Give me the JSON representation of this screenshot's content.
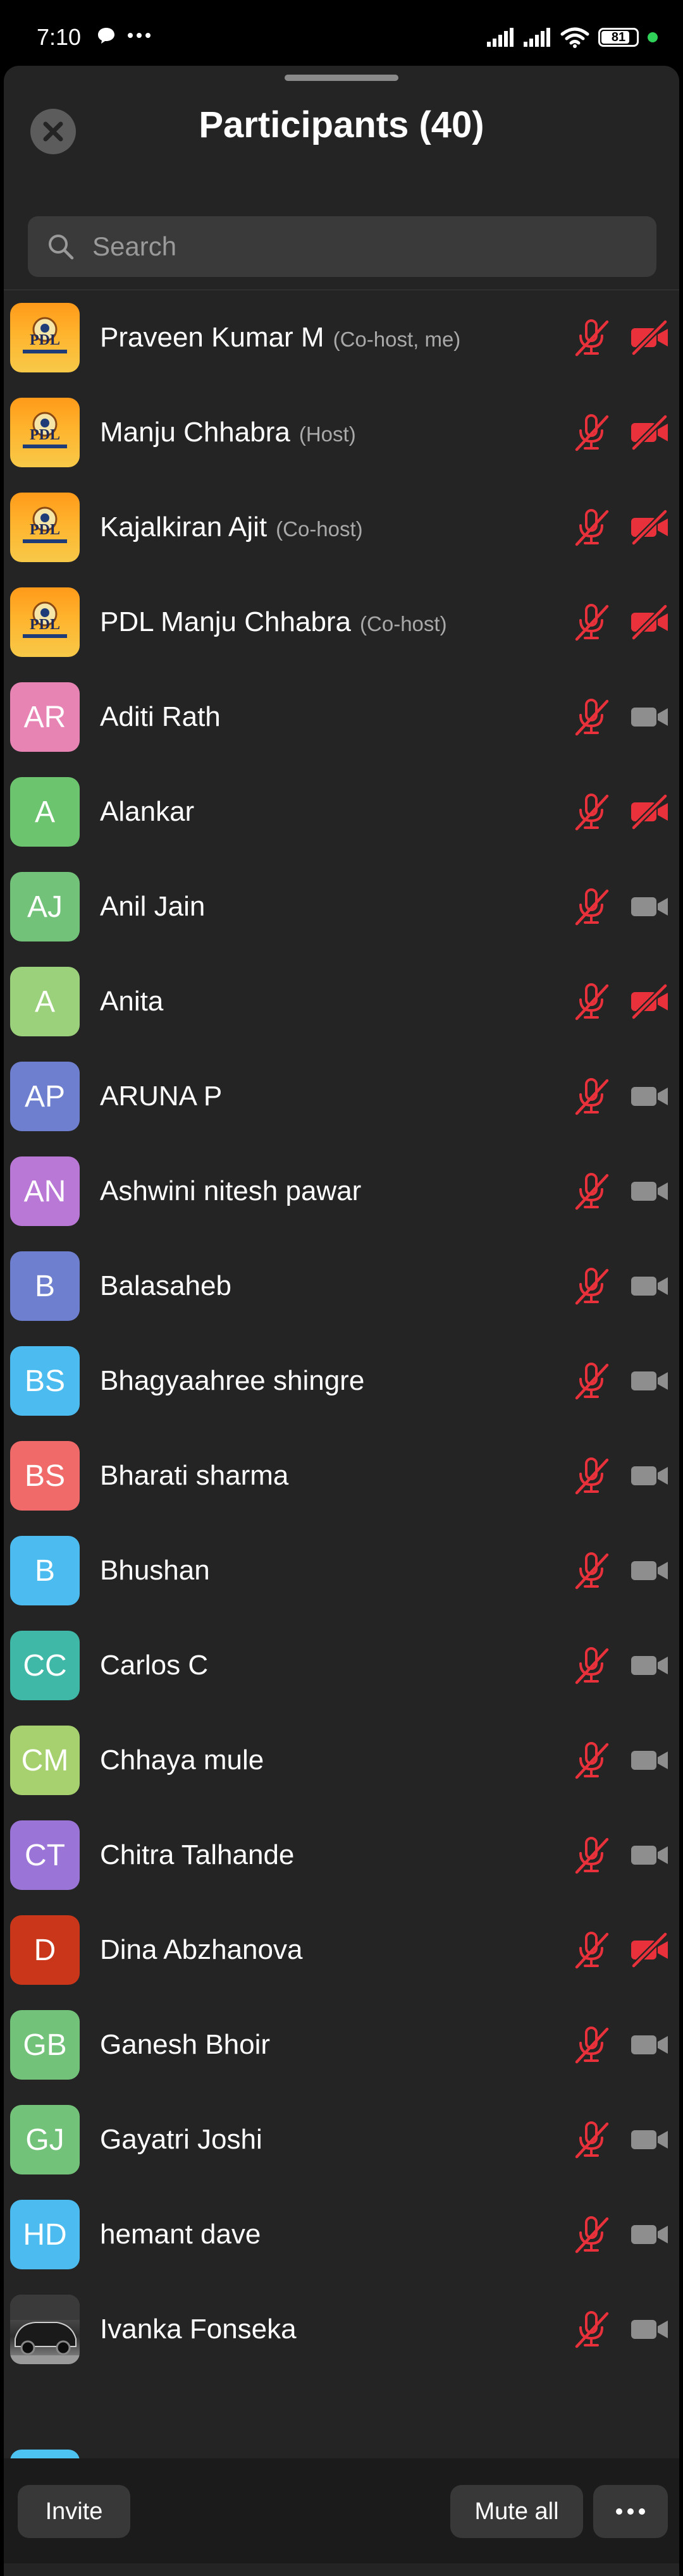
{
  "status_bar": {
    "time": "7:10",
    "battery": "81",
    "battery_level": 0.81,
    "left_icons": [
      "chat-bubble-icon",
      "more-dots-icon"
    ],
    "right_icons": [
      "signal-icon",
      "signal-icon",
      "wifi-icon",
      "battery-icon",
      "green-dot-indicator"
    ]
  },
  "header": {
    "title": "Participants (40)",
    "close_icon": "close-icon"
  },
  "search": {
    "placeholder": "Search",
    "value": ""
  },
  "colors": {
    "sheet_bg": "#242424",
    "muted_red": "#e8313b",
    "camera_grey": "#8e8e8e"
  },
  "participants": [
    {
      "name": "Praveen Kumar M",
      "role": "(Co-host, me)",
      "avatar": "PDL",
      "avatar_kind": "logo",
      "color": "",
      "mic_muted": true,
      "video_off": true
    },
    {
      "name": "Manju Chhabra",
      "role": "(Host)",
      "avatar": "PDL",
      "avatar_kind": "logo",
      "color": "",
      "mic_muted": true,
      "video_off": true
    },
    {
      "name": "Kajalkiran Ajit",
      "role": "(Co-host)",
      "avatar": "PDL",
      "avatar_kind": "logo",
      "color": "",
      "mic_muted": true,
      "video_off": true
    },
    {
      "name": "PDL Manju Chhabra",
      "role": "(Co-host)",
      "avatar": "PDL",
      "avatar_kind": "logo",
      "color": "",
      "mic_muted": true,
      "video_off": true
    },
    {
      "name": "Aditi Rath",
      "role": "",
      "avatar": "AR",
      "avatar_kind": "initials",
      "color": "#e784b4",
      "mic_muted": true,
      "video_off": false
    },
    {
      "name": "Alankar",
      "role": "",
      "avatar": "A",
      "avatar_kind": "initials",
      "color": "#6cc46f",
      "mic_muted": true,
      "video_off": true
    },
    {
      "name": "Anil Jain",
      "role": "",
      "avatar": "AJ",
      "avatar_kind": "initials",
      "color": "#72c27a",
      "mic_muted": true,
      "video_off": false
    },
    {
      "name": "Anita",
      "role": "",
      "avatar": "A",
      "avatar_kind": "initials",
      "color": "#9bd17a",
      "mic_muted": true,
      "video_off": true
    },
    {
      "name": "ARUNA P",
      "role": "",
      "avatar": "AP",
      "avatar_kind": "initials",
      "color": "#6f7fcf",
      "mic_muted": true,
      "video_off": false
    },
    {
      "name": "Ashwini nitesh pawar",
      "role": "",
      "avatar": "AN",
      "avatar_kind": "initials",
      "color": "#b977d6",
      "mic_muted": true,
      "video_off": false
    },
    {
      "name": "Balasaheb",
      "role": "",
      "avatar": "B",
      "avatar_kind": "initials",
      "color": "#6f7fcf",
      "mic_muted": true,
      "video_off": false
    },
    {
      "name": "Bhagyaahree shingre",
      "role": "",
      "avatar": "BS",
      "avatar_kind": "initials",
      "color": "#4cbcf0",
      "mic_muted": true,
      "video_off": false
    },
    {
      "name": "Bharati sharma",
      "role": "",
      "avatar": "BS",
      "avatar_kind": "initials",
      "color": "#f06a6a",
      "mic_muted": true,
      "video_off": false
    },
    {
      "name": "Bhushan",
      "role": "",
      "avatar": "B",
      "avatar_kind": "initials",
      "color": "#4cbcf0",
      "mic_muted": true,
      "video_off": false
    },
    {
      "name": "Carlos C",
      "role": "",
      "avatar": "CC",
      "avatar_kind": "initials",
      "color": "#3fb8a8",
      "mic_muted": true,
      "video_off": false
    },
    {
      "name": "Chhaya mule",
      "role": "",
      "avatar": "CM",
      "avatar_kind": "initials",
      "color": "#a6d16e",
      "mic_muted": true,
      "video_off": false
    },
    {
      "name": "Chitra Talhande",
      "role": "",
      "avatar": "CT",
      "avatar_kind": "initials",
      "color": "#9a74d6",
      "mic_muted": true,
      "video_off": false
    },
    {
      "name": "Dina Abzhanova",
      "role": "",
      "avatar": "D",
      "avatar_kind": "initials",
      "color": "#c9361a",
      "mic_muted": true,
      "video_off": true
    },
    {
      "name": "Ganesh Bhoir",
      "role": "",
      "avatar": "GB",
      "avatar_kind": "initials",
      "color": "#72c27a",
      "mic_muted": true,
      "video_off": false
    },
    {
      "name": "Gayatri Joshi",
      "role": "",
      "avatar": "GJ",
      "avatar_kind": "initials",
      "color": "#72c27a",
      "mic_muted": true,
      "video_off": false
    },
    {
      "name": "hemant dave",
      "role": "",
      "avatar": "HD",
      "avatar_kind": "initials",
      "color": "#4cbcf0",
      "mic_muted": true,
      "video_off": false
    },
    {
      "name": "Ivanka Fonseka",
      "role": "",
      "avatar": "",
      "avatar_kind": "photo",
      "color": "",
      "mic_muted": true,
      "video_off": false
    }
  ],
  "footer": {
    "invite_label": "Invite",
    "mute_all_label": "Mute all",
    "more_icon": "more-horizontal-icon"
  }
}
